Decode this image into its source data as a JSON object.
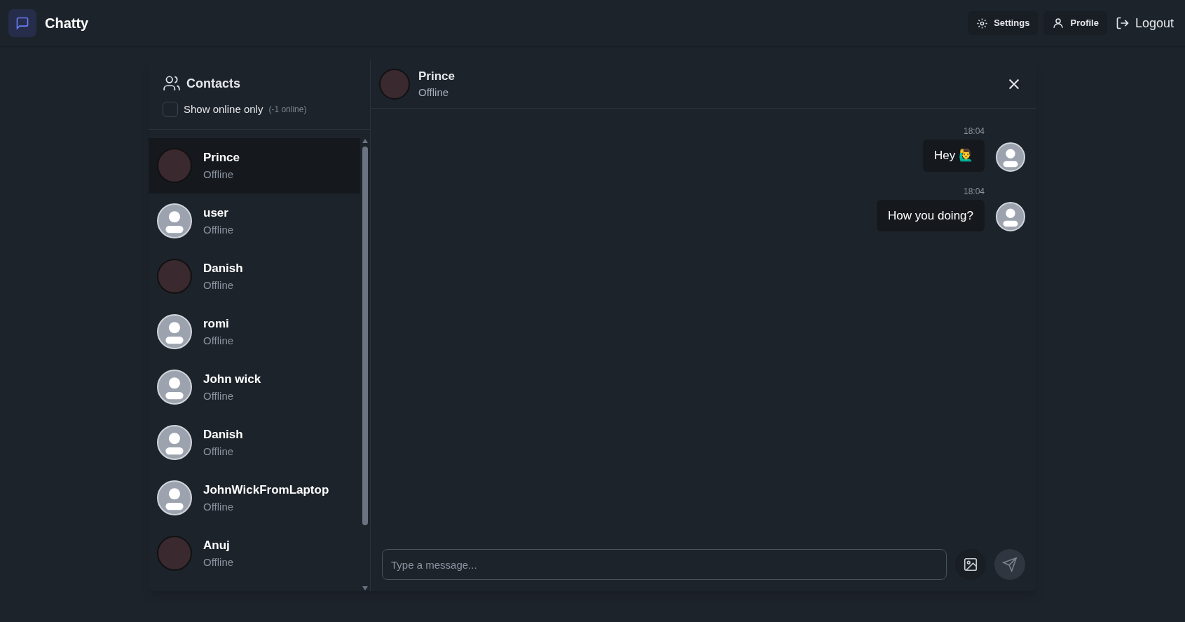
{
  "navbar": {
    "brand": "Chatty",
    "actions": [
      {
        "kind": "settings",
        "label": "Settings"
      },
      {
        "kind": "profile",
        "label": "Profile"
      },
      {
        "kind": "logout",
        "label": "Logout"
      }
    ]
  },
  "sidebar": {
    "title": "Contacts",
    "filter": {
      "label": "Show online only",
      "checked": false,
      "count": "(-1 online)"
    },
    "contacts": [
      {
        "name": "Prince",
        "status": "Offline",
        "kind": "picture",
        "selected": true
      },
      {
        "name": "user",
        "status": "Offline",
        "kind": "default",
        "selected": false
      },
      {
        "name": "Danish",
        "status": "Offline",
        "kind": "picture",
        "selected": false
      },
      {
        "name": "romi",
        "status": "Offline",
        "kind": "default",
        "selected": false
      },
      {
        "name": "John wick",
        "status": "Offline",
        "kind": "default",
        "selected": false
      },
      {
        "name": "Danish",
        "status": "Offline",
        "kind": "default",
        "selected": false
      },
      {
        "name": "JohnWickFromLaptop",
        "status": "Offline",
        "kind": "default",
        "selected": false
      },
      {
        "name": "Anuj",
        "status": "Offline",
        "kind": "picture",
        "selected": false
      }
    ]
  },
  "chat": {
    "header": {
      "name": "Prince",
      "status": "Offline",
      "kind": "picture"
    },
    "messages": [
      {
        "time": "18:04",
        "text": "Hey 🙋‍♂️",
        "kind": "default"
      },
      {
        "time": "18:04",
        "text": "How you doing?",
        "kind": "default"
      }
    ],
    "composer": {
      "placeholder": "Type a message..."
    }
  }
}
